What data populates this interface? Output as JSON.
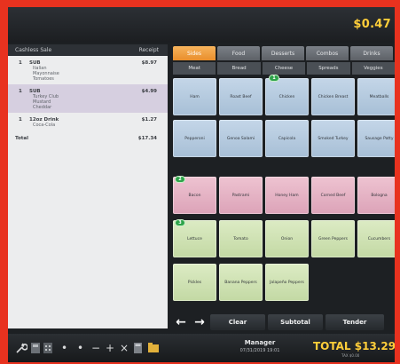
{
  "header": {
    "amount": "$0.47"
  },
  "order": {
    "columns": [
      "Cashless Sale",
      "Receipt"
    ],
    "groups": [
      {
        "qty": "1",
        "name": "SUB",
        "price": "$8.97",
        "mods": [
          "Italian",
          "Mayonnaise",
          "Tomatoes"
        ],
        "selected": false
      },
      {
        "qty": "1",
        "name": "SUB",
        "price": "$4.99",
        "mods": [
          "Turkey Club",
          "Mustard",
          "Cheddar"
        ],
        "selected": true
      },
      {
        "qty": "1",
        "name": "12oz Drink",
        "price": "$1.27",
        "mods": [
          "Coca-Cola"
        ],
        "selected": false
      }
    ],
    "total_label": "Total",
    "total_value": "$17.34"
  },
  "tabs": [
    "Sides",
    "Food",
    "Desserts",
    "Combos",
    "Drinks"
  ],
  "subtabs": [
    "Meat",
    "Bread",
    "Cheese",
    "Spreads",
    "Veggies"
  ],
  "buttons": {
    "blue": [
      "Ham",
      "Roast Beef",
      "Chicken",
      "Chicken Breast",
      "Meatballs",
      "Pepperoni",
      "Genoa Salami",
      "Capicola",
      "Smoked Turkey",
      "Sausage Patty"
    ],
    "pink": [
      "Bacon",
      "Pastrami",
      "Honey Ham",
      "Corned Beef",
      "Bologna"
    ],
    "green": [
      "Lettuce",
      "Tomato",
      "Onion",
      "Green Peppers",
      "Cucumbers",
      "Pickles",
      "Banana Peppers",
      "Jalapeño Peppers"
    ]
  },
  "badges": [
    "1",
    "2",
    "3"
  ],
  "actions": {
    "prev": "←",
    "next": "→",
    "clear": "Clear",
    "subtotal": "Subtotal",
    "tender": "Tender"
  },
  "footer": {
    "user": "Manager",
    "datetime": "07/31/2019 19:01",
    "total": "TOTAL $13.29",
    "tax_note": "TAX $0.00"
  },
  "colors": {
    "accent": "#ffce3a",
    "border": "#e8321f",
    "active_tab": "#f0a045"
  }
}
